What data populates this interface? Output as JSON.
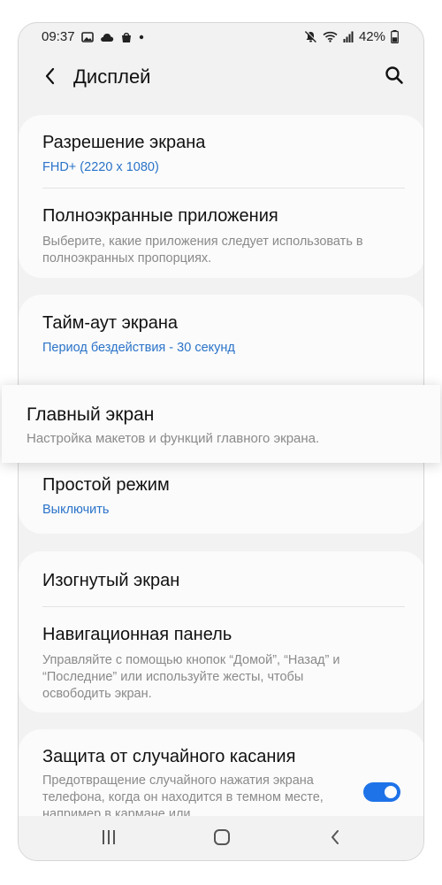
{
  "status_bar": {
    "time": "09:37",
    "battery_percent": "42%",
    "icons_left": [
      "gallery-icon",
      "cloud-icon",
      "shopping-bag-icon",
      "dot-icon"
    ],
    "icons_right": [
      "mute-icon",
      "wifi-icon",
      "signal-icon",
      "battery-icon"
    ]
  },
  "header": {
    "title": "Дисплей",
    "back_icon": "chevron-left-icon",
    "search_icon": "search-icon"
  },
  "settings": {
    "resolution": {
      "title": "Разрешение экрана",
      "value": "FHD+ (2220 x 1080)"
    },
    "fullscreen_apps": {
      "title": "Полноэкранные приложения",
      "description": "Выберите, какие приложения следует использовать в полноэкранных пропорциях."
    },
    "screen_timeout": {
      "title": "Тайм-аут экрана",
      "value": "Период бездействия - 30 секунд"
    },
    "home_screen": {
      "title": "Главный экран",
      "description": "Настройка макетов и функций главного экрана."
    },
    "easy_mode": {
      "title": "Простой режим",
      "value": "Выключить"
    },
    "edge_screen": {
      "title": "Изогнутый экран"
    },
    "navigation_bar": {
      "title": "Навигационная панель",
      "description": "Управляйте с помощью кнопок “Домой”, “Назад” и “Последние” или используйте жесты, чтобы освободить экран."
    },
    "accidental_touch": {
      "title": "Защита от случайного касания",
      "description": "Предотвращение случайного нажатия экрана телефона, когда он находится в темном месте, например в кармане или",
      "enabled": true
    }
  },
  "nav_bar": {
    "icons": [
      "recents-icon",
      "home-icon",
      "back-icon"
    ]
  },
  "colors": {
    "accent": "#1e73e8",
    "link": "#2a73c9",
    "background": "#f2f2f2",
    "card": "#fbfbfb"
  }
}
